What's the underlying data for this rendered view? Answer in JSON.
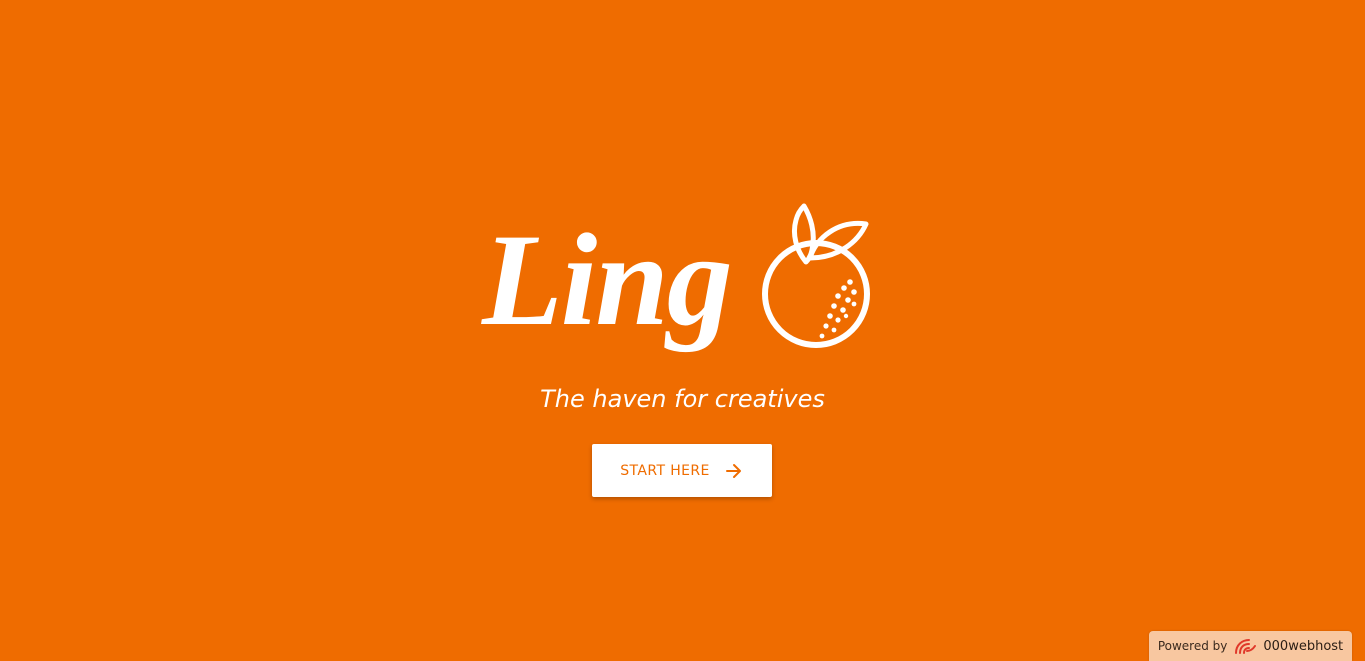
{
  "logo": {
    "text": "Ling",
    "icon": "orange-fruit-icon"
  },
  "tagline": "The haven for creatives",
  "cta": {
    "label": "START HERE",
    "icon": "arrow-right-icon"
  },
  "footer": {
    "powered_label": "Powered by",
    "host_name": "000webhost",
    "host_icon": "000webhost-logo-icon"
  },
  "colors": {
    "background": "#ef6c00",
    "accent": "#ef6c00",
    "button_background": "#ffffff",
    "badge_background": "#f8c7a0"
  }
}
